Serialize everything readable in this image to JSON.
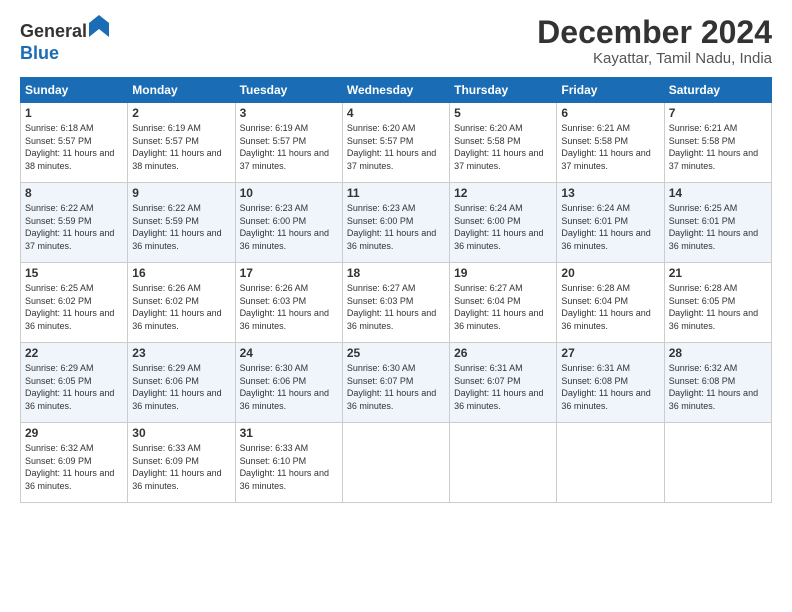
{
  "header": {
    "logo_general": "General",
    "logo_blue": "Blue",
    "month_title": "December 2024",
    "location": "Kayattar, Tamil Nadu, India"
  },
  "weekdays": [
    "Sunday",
    "Monday",
    "Tuesday",
    "Wednesday",
    "Thursday",
    "Friday",
    "Saturday"
  ],
  "weeks": [
    [
      {
        "day": "1",
        "sunrise": "Sunrise: 6:18 AM",
        "sunset": "Sunset: 5:57 PM",
        "daylight": "Daylight: 11 hours and 38 minutes."
      },
      {
        "day": "2",
        "sunrise": "Sunrise: 6:19 AM",
        "sunset": "Sunset: 5:57 PM",
        "daylight": "Daylight: 11 hours and 38 minutes."
      },
      {
        "day": "3",
        "sunrise": "Sunrise: 6:19 AM",
        "sunset": "Sunset: 5:57 PM",
        "daylight": "Daylight: 11 hours and 37 minutes."
      },
      {
        "day": "4",
        "sunrise": "Sunrise: 6:20 AM",
        "sunset": "Sunset: 5:57 PM",
        "daylight": "Daylight: 11 hours and 37 minutes."
      },
      {
        "day": "5",
        "sunrise": "Sunrise: 6:20 AM",
        "sunset": "Sunset: 5:58 PM",
        "daylight": "Daylight: 11 hours and 37 minutes."
      },
      {
        "day": "6",
        "sunrise": "Sunrise: 6:21 AM",
        "sunset": "Sunset: 5:58 PM",
        "daylight": "Daylight: 11 hours and 37 minutes."
      },
      {
        "day": "7",
        "sunrise": "Sunrise: 6:21 AM",
        "sunset": "Sunset: 5:58 PM",
        "daylight": "Daylight: 11 hours and 37 minutes."
      }
    ],
    [
      {
        "day": "8",
        "sunrise": "Sunrise: 6:22 AM",
        "sunset": "Sunset: 5:59 PM",
        "daylight": "Daylight: 11 hours and 37 minutes."
      },
      {
        "day": "9",
        "sunrise": "Sunrise: 6:22 AM",
        "sunset": "Sunset: 5:59 PM",
        "daylight": "Daylight: 11 hours and 36 minutes."
      },
      {
        "day": "10",
        "sunrise": "Sunrise: 6:23 AM",
        "sunset": "Sunset: 6:00 PM",
        "daylight": "Daylight: 11 hours and 36 minutes."
      },
      {
        "day": "11",
        "sunrise": "Sunrise: 6:23 AM",
        "sunset": "Sunset: 6:00 PM",
        "daylight": "Daylight: 11 hours and 36 minutes."
      },
      {
        "day": "12",
        "sunrise": "Sunrise: 6:24 AM",
        "sunset": "Sunset: 6:00 PM",
        "daylight": "Daylight: 11 hours and 36 minutes."
      },
      {
        "day": "13",
        "sunrise": "Sunrise: 6:24 AM",
        "sunset": "Sunset: 6:01 PM",
        "daylight": "Daylight: 11 hours and 36 minutes."
      },
      {
        "day": "14",
        "sunrise": "Sunrise: 6:25 AM",
        "sunset": "Sunset: 6:01 PM",
        "daylight": "Daylight: 11 hours and 36 minutes."
      }
    ],
    [
      {
        "day": "15",
        "sunrise": "Sunrise: 6:25 AM",
        "sunset": "Sunset: 6:02 PM",
        "daylight": "Daylight: 11 hours and 36 minutes."
      },
      {
        "day": "16",
        "sunrise": "Sunrise: 6:26 AM",
        "sunset": "Sunset: 6:02 PM",
        "daylight": "Daylight: 11 hours and 36 minutes."
      },
      {
        "day": "17",
        "sunrise": "Sunrise: 6:26 AM",
        "sunset": "Sunset: 6:03 PM",
        "daylight": "Daylight: 11 hours and 36 minutes."
      },
      {
        "day": "18",
        "sunrise": "Sunrise: 6:27 AM",
        "sunset": "Sunset: 6:03 PM",
        "daylight": "Daylight: 11 hours and 36 minutes."
      },
      {
        "day": "19",
        "sunrise": "Sunrise: 6:27 AM",
        "sunset": "Sunset: 6:04 PM",
        "daylight": "Daylight: 11 hours and 36 minutes."
      },
      {
        "day": "20",
        "sunrise": "Sunrise: 6:28 AM",
        "sunset": "Sunset: 6:04 PM",
        "daylight": "Daylight: 11 hours and 36 minutes."
      },
      {
        "day": "21",
        "sunrise": "Sunrise: 6:28 AM",
        "sunset": "Sunset: 6:05 PM",
        "daylight": "Daylight: 11 hours and 36 minutes."
      }
    ],
    [
      {
        "day": "22",
        "sunrise": "Sunrise: 6:29 AM",
        "sunset": "Sunset: 6:05 PM",
        "daylight": "Daylight: 11 hours and 36 minutes."
      },
      {
        "day": "23",
        "sunrise": "Sunrise: 6:29 AM",
        "sunset": "Sunset: 6:06 PM",
        "daylight": "Daylight: 11 hours and 36 minutes."
      },
      {
        "day": "24",
        "sunrise": "Sunrise: 6:30 AM",
        "sunset": "Sunset: 6:06 PM",
        "daylight": "Daylight: 11 hours and 36 minutes."
      },
      {
        "day": "25",
        "sunrise": "Sunrise: 6:30 AM",
        "sunset": "Sunset: 6:07 PM",
        "daylight": "Daylight: 11 hours and 36 minutes."
      },
      {
        "day": "26",
        "sunrise": "Sunrise: 6:31 AM",
        "sunset": "Sunset: 6:07 PM",
        "daylight": "Daylight: 11 hours and 36 minutes."
      },
      {
        "day": "27",
        "sunrise": "Sunrise: 6:31 AM",
        "sunset": "Sunset: 6:08 PM",
        "daylight": "Daylight: 11 hours and 36 minutes."
      },
      {
        "day": "28",
        "sunrise": "Sunrise: 6:32 AM",
        "sunset": "Sunset: 6:08 PM",
        "daylight": "Daylight: 11 hours and 36 minutes."
      }
    ],
    [
      {
        "day": "29",
        "sunrise": "Sunrise: 6:32 AM",
        "sunset": "Sunset: 6:09 PM",
        "daylight": "Daylight: 11 hours and 36 minutes."
      },
      {
        "day": "30",
        "sunrise": "Sunrise: 6:33 AM",
        "sunset": "Sunset: 6:09 PM",
        "daylight": "Daylight: 11 hours and 36 minutes."
      },
      {
        "day": "31",
        "sunrise": "Sunrise: 6:33 AM",
        "sunset": "Sunset: 6:10 PM",
        "daylight": "Daylight: 11 hours and 36 minutes."
      },
      null,
      null,
      null,
      null
    ]
  ]
}
